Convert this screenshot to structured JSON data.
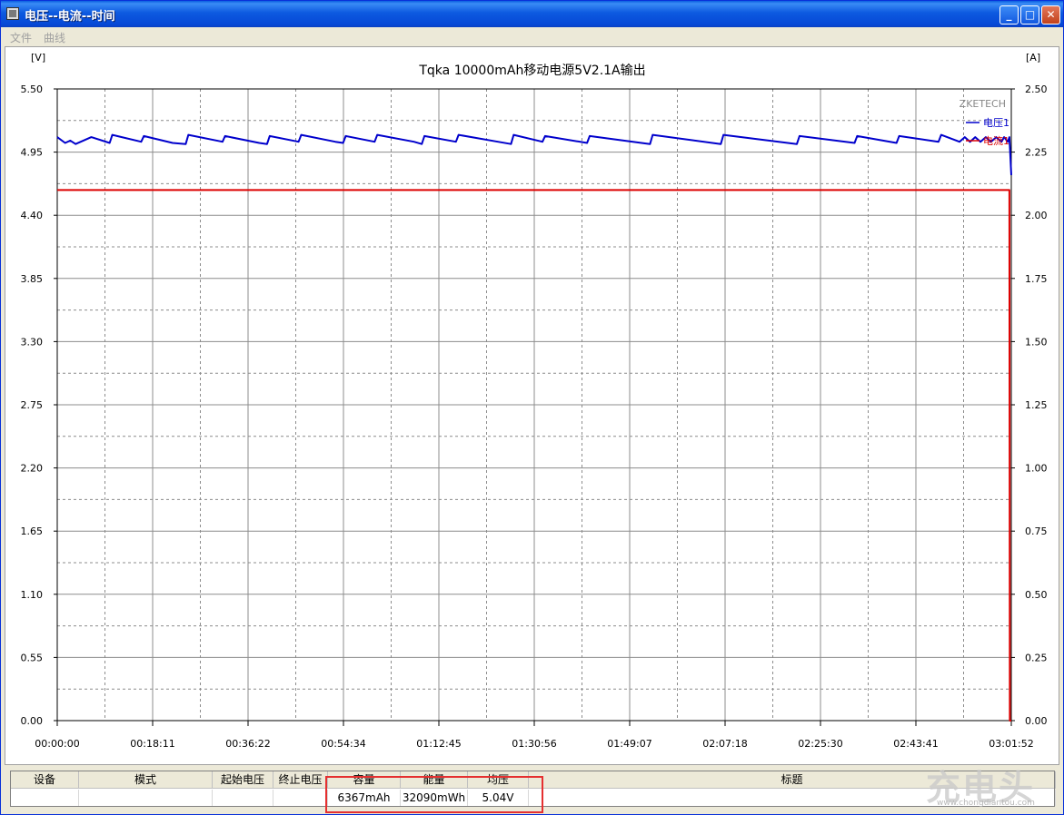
{
  "window": {
    "title": "电压--电流--时间",
    "controls": {
      "minimize": "_",
      "maximize": "□",
      "close": "✕"
    }
  },
  "menu": {
    "items": [
      "文件",
      "曲线"
    ]
  },
  "chart_data": {
    "type": "line",
    "title": "Tqka 10000mAh移动电源5V2.1A输出",
    "watermark": "ZKETECH",
    "y_left_unit": "[V]",
    "y_right_unit": "[A]",
    "y_left_ticks": [
      "5.50",
      "4.95",
      "4.40",
      "3.85",
      "3.30",
      "2.75",
      "2.20",
      "1.65",
      "1.10",
      "0.55",
      "0.00"
    ],
    "y_right_ticks": [
      "2.50",
      "2.25",
      "2.00",
      "1.75",
      "1.50",
      "1.25",
      "1.00",
      "0.75",
      "0.50",
      "0.25",
      "0.00"
    ],
    "x_ticks": [
      "00:00:00",
      "00:18:11",
      "00:36:22",
      "00:54:34",
      "01:12:45",
      "01:30:56",
      "01:49:07",
      "02:07:18",
      "02:25:30",
      "02:43:41",
      "03:01:52"
    ],
    "ylim_left": [
      0,
      5.5
    ],
    "ylim_right": [
      0,
      2.5
    ],
    "xlim_minutes": [
      0,
      181.87
    ],
    "legend_placement": "top-right",
    "grid": true,
    "series": [
      {
        "name": "电压1",
        "axis": "left",
        "color": "#0000cc",
        "x_minutes": [
          0,
          1.5,
          2.5,
          3.5,
          6.5,
          10.0,
          10.5,
          16.0,
          16.5,
          22.0,
          24.5,
          25.0,
          31.5,
          32.0,
          38.5,
          40.0,
          40.5,
          46.0,
          46.5,
          53.0,
          54.5,
          55.0,
          60.5,
          61.0,
          68.0,
          69.5,
          70.0,
          76.0,
          76.5,
          84.0,
          86.5,
          87.0,
          92.5,
          93.0,
          101.0,
          101.5,
          113.0,
          113.5,
          126.5,
          127.0,
          141.0,
          141.5,
          152.0,
          152.5,
          160.0,
          160.5,
          168.0,
          168.5,
          172.0,
          173.0,
          174.0,
          175.0,
          176.0,
          177.0,
          178.0,
          179.0,
          180.0,
          180.5,
          181.2,
          181.5,
          181.87
        ],
        "values": [
          5.08,
          5.03,
          5.05,
          5.02,
          5.08,
          5.03,
          5.1,
          5.04,
          5.09,
          5.03,
          5.02,
          5.1,
          5.04,
          5.09,
          5.03,
          5.02,
          5.09,
          5.04,
          5.1,
          5.04,
          5.03,
          5.09,
          5.04,
          5.1,
          5.04,
          5.02,
          5.09,
          5.04,
          5.1,
          5.04,
          5.02,
          5.1,
          5.04,
          5.09,
          5.03,
          5.09,
          5.02,
          5.1,
          5.02,
          5.1,
          5.02,
          5.09,
          5.03,
          5.09,
          5.03,
          5.09,
          5.04,
          5.1,
          5.04,
          5.08,
          5.04,
          5.08,
          5.04,
          5.08,
          5.04,
          5.08,
          5.04,
          5.08,
          5.04,
          5.08,
          4.75
        ]
      },
      {
        "name": "电流1",
        "axis": "right",
        "color": "#dd0000",
        "x_minutes": [
          0,
          181.5,
          181.6,
          181.87
        ],
        "values": [
          2.1,
          2.1,
          0.0,
          0.0
        ]
      }
    ]
  },
  "summary_table": {
    "headers": [
      "设备",
      "模式",
      "起始电压",
      "终止电压",
      "容量",
      "能量",
      "均压",
      "标题"
    ],
    "values": [
      "",
      "",
      "",
      "",
      "6367mAh",
      "32090mWh",
      "5.04V",
      ""
    ]
  },
  "watermark_site": {
    "logo_text": "充电头",
    "url": "www.chongdiantou.com"
  },
  "highlight_color": "#e53030"
}
